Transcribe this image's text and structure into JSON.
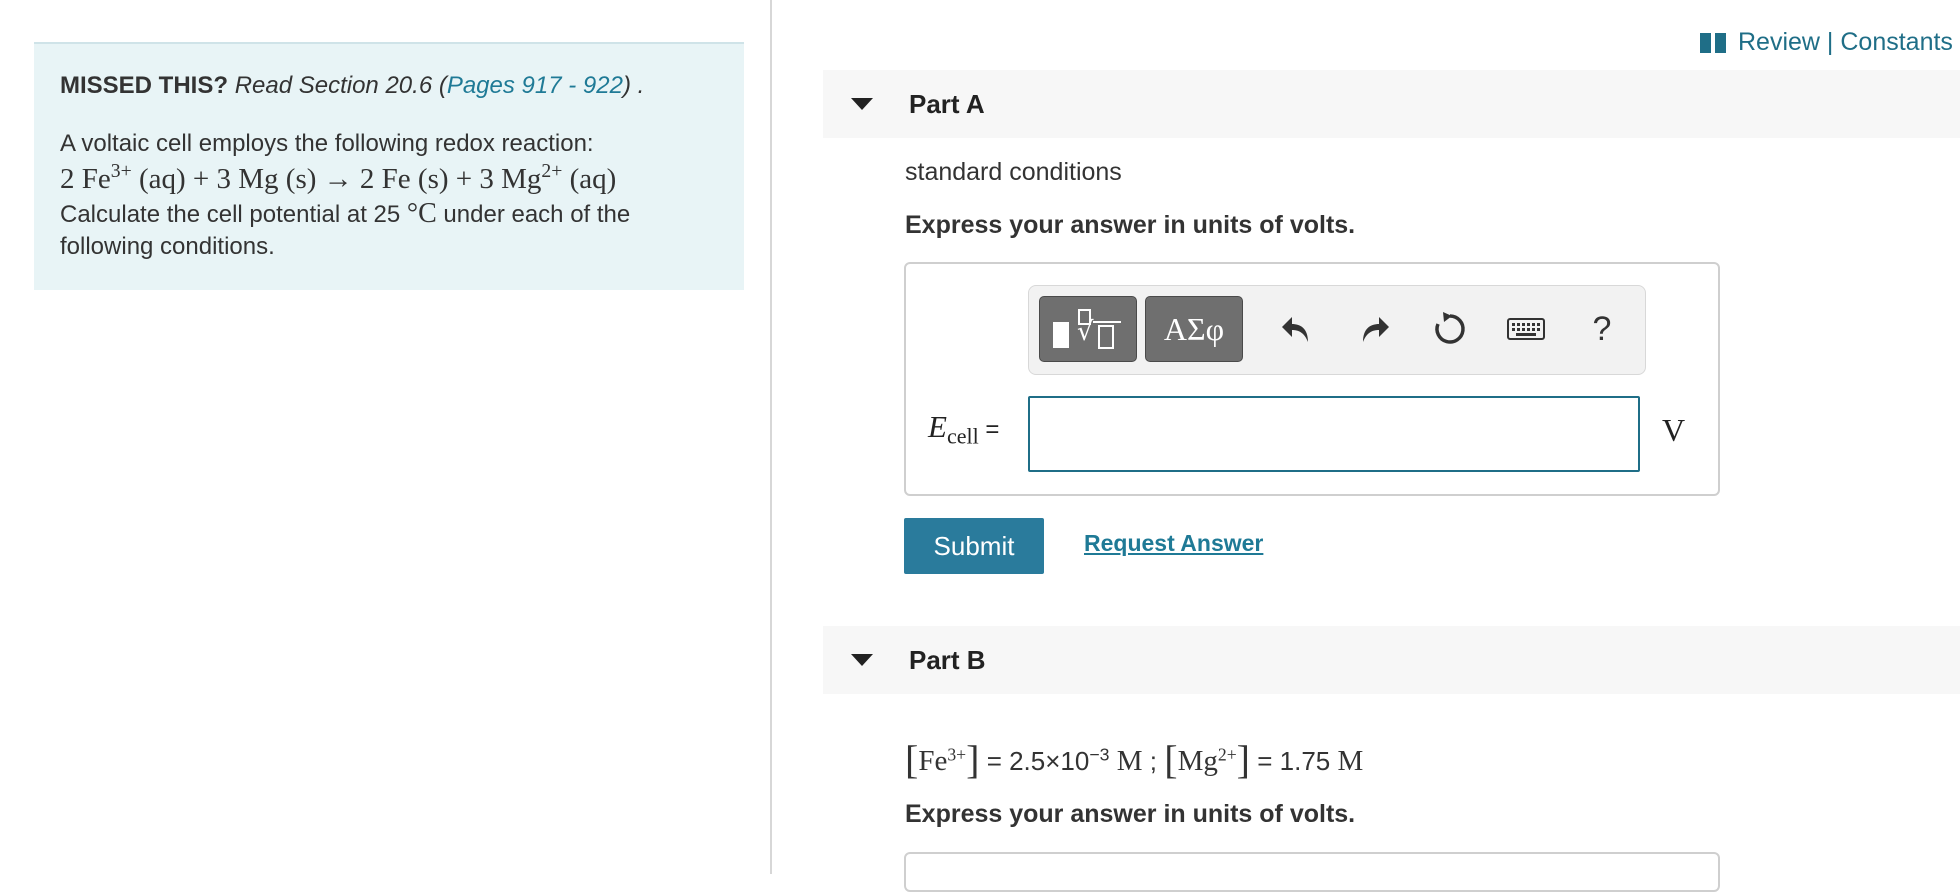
{
  "left_panel": {
    "missed_label": "MISSED THIS?",
    "read_text": "Read Section 20.6 (",
    "pages_link": "Pages 917 - 922",
    "read_end": ") .",
    "intro": "A voltaic cell employs the following redox reaction:",
    "reaction": {
      "c1": "2 Fe",
      "c1_sup": "3+",
      "c1_state": " (aq) + 3 Mg (s) ",
      "arrow": "→",
      "c2": " 2 Fe (s) + 3 Mg",
      "c2_sup": "2+",
      "c2_state": " (aq)"
    },
    "question_pre": "Calculate the cell potential at 25 ",
    "degree": "°C",
    "question_post": " under each of the following conditions."
  },
  "header": {
    "review_label": "Review | Constants"
  },
  "part_a": {
    "title": "Part A",
    "condition": "standard conditions",
    "instruction": "Express your answer in units of volts.",
    "variable": "E",
    "variable_sub": "cell",
    "equals": " =",
    "unit": "V",
    "input_value": "",
    "submit_label": "Submit",
    "request_label": "Request Answer"
  },
  "toolbar": {
    "templates_label": "√",
    "symbols_label": "ΑΣφ",
    "help_label": "?"
  },
  "part_b": {
    "title": "Part B",
    "fe": "Fe",
    "fe_sup": "3+",
    "eq1": " = 2.5×10",
    "eq1_exp": "−3",
    "unit1": " M",
    "sep": " ; ",
    "mg": "Mg",
    "mg_sup": "2+",
    "eq2": " = 1.75",
    "unit2": " M",
    "instruction": "Express your answer in units of volts."
  },
  "colors": {
    "accent": "#2a7b9c",
    "link": "#1f7a96",
    "panel_bg": "#e8f4f6"
  }
}
